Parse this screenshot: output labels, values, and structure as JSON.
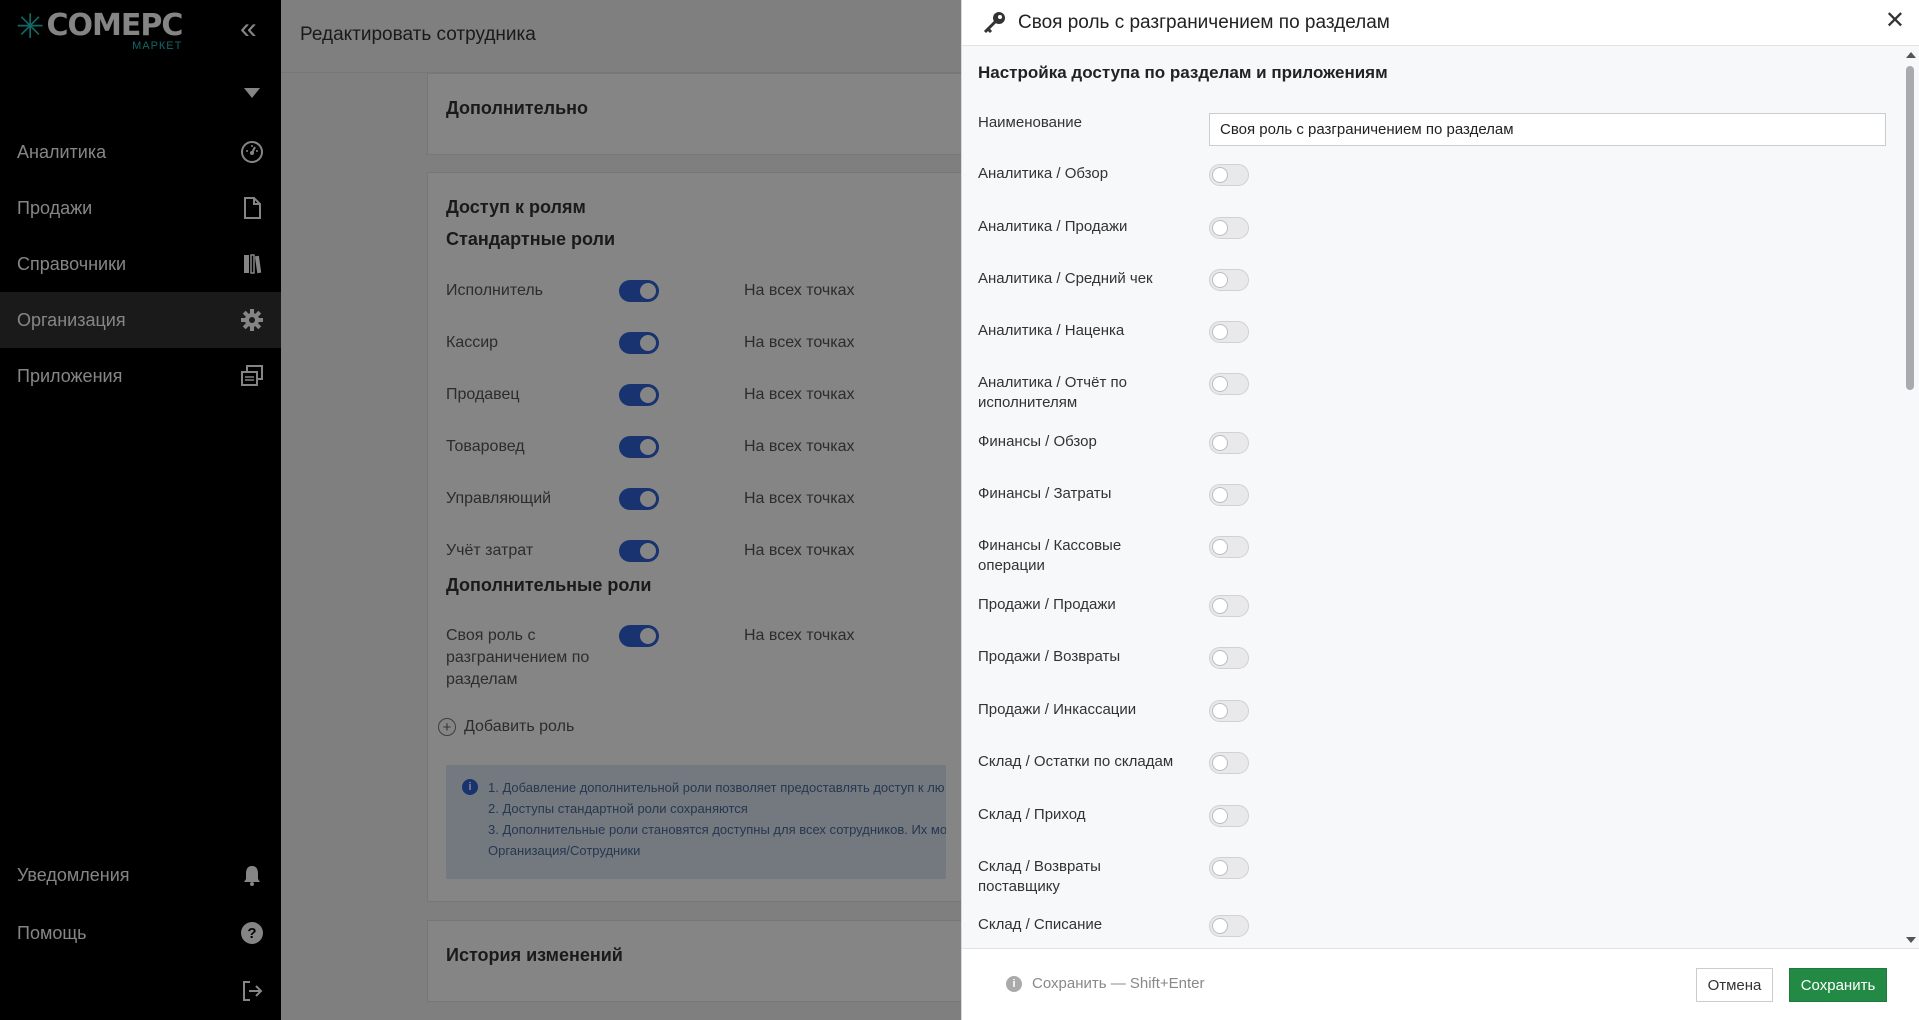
{
  "sidebar": {
    "logo_main": "COMEPC",
    "logo_sub": "МАРКЕТ",
    "items": [
      {
        "label": "Аналитика",
        "icon": "gauge-icon"
      },
      {
        "label": "Продажи",
        "icon": "document-icon"
      },
      {
        "label": "Справочники",
        "icon": "books-icon"
      },
      {
        "label": "Организация",
        "icon": "gear-icon",
        "active": true
      },
      {
        "label": "Приложения",
        "icon": "windows-icon"
      }
    ],
    "bottom": [
      {
        "label": "Уведомления",
        "icon": "bell-icon"
      },
      {
        "label": "Помощь",
        "icon": "help-icon"
      }
    ]
  },
  "main": {
    "title": "Редактировать сотрудника",
    "extra_title": "Дополнительно",
    "roles_title": "Доступ к ролям",
    "standard_title": "Стандартные роли",
    "standard_roles": [
      {
        "name": "Исполнитель",
        "scope": "На всех точках"
      },
      {
        "name": "Кассир",
        "scope": "На всех точках"
      },
      {
        "name": "Продавец",
        "scope": "На всех точках"
      },
      {
        "name": "Товаровед",
        "scope": "На всех точках"
      },
      {
        "name": "Управляющий",
        "scope": "На всех точках"
      },
      {
        "name": "Учёт затрат",
        "scope": "На всех точках"
      }
    ],
    "additional_title": "Дополнительные роли",
    "additional_role": {
      "name": "Своя роль с разграничением по разделам",
      "scope": "На всех точках"
    },
    "add_role": "Добавить роль",
    "info_lines": [
      "1. Добавление дополнительной роли позволяет предоставлять доступ к лю",
      "2. Доступы стандартной роли сохраняются",
      "3. Дополнительные роли становятся доступны для всех сотрудников. Их мо",
      "Организация/Сотрудники"
    ],
    "history_title": "История изменений"
  },
  "modal": {
    "title": "Своя роль с разграничением по разделам",
    "section_title": "Настройка доступа по разделам и приложениям",
    "name_label": "Наименование",
    "name_value": "Своя роль с разграничением по разделам",
    "permissions": [
      {
        "label": "Аналитика / Обзор",
        "on": false
      },
      {
        "label": "Аналитика / Продажи",
        "on": false
      },
      {
        "label": "Аналитика / Средний чек",
        "on": false
      },
      {
        "label": "Аналитика / Наценка",
        "on": false
      },
      {
        "label": "Аналитика / Отчёт по исполнителям",
        "on": false
      },
      {
        "label": "Финансы / Обзор",
        "on": false
      },
      {
        "label": "Финансы / Затраты",
        "on": false
      },
      {
        "label": "Финансы / Кассовые операции",
        "on": false
      },
      {
        "label": "Продажи / Продажи",
        "on": false
      },
      {
        "label": "Продажи / Возвраты",
        "on": false
      },
      {
        "label": "Продажи / Инкассации",
        "on": false
      },
      {
        "label": "Склад / Остатки по складам",
        "on": false
      },
      {
        "label": "Склад / Приход",
        "on": false
      },
      {
        "label": "Склад / Возвраты поставщику",
        "on": false
      },
      {
        "label": "Склад / Списание",
        "on": false
      }
    ],
    "hint": "Сохранить — Shift+Enter",
    "cancel": "Отмена",
    "save": "Сохранить"
  },
  "colors": {
    "accent": "#2f63d6",
    "brand": "#23c6c0",
    "save": "#238a45"
  }
}
